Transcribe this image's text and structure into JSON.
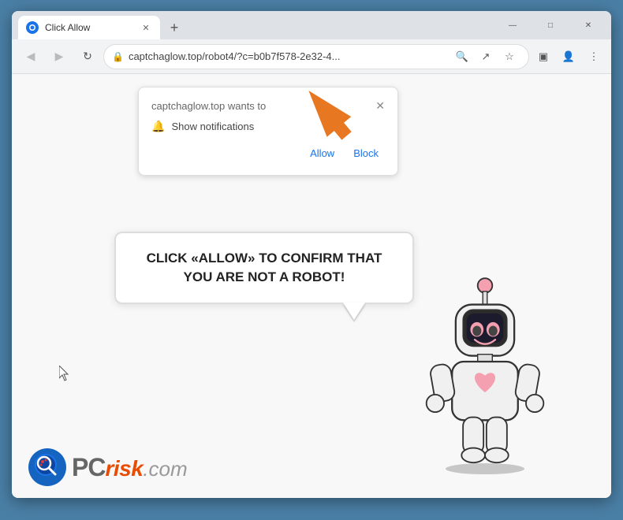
{
  "browser": {
    "tab": {
      "title": "Click Allow",
      "favicon_label": "chrome-favicon"
    },
    "window_controls": {
      "minimize": "—",
      "maximize": "□",
      "close": "✕"
    },
    "nav": {
      "back_label": "◀",
      "forward_label": "▶",
      "reload_label": "↻",
      "url": "captchaglow.top/robot4/?c=b0b7f578-2e32-4...",
      "search_icon": "🔍",
      "share_icon": "↗",
      "bookmark_icon": "☆",
      "extensions_icon": "▣",
      "profile_icon": "👤",
      "menu_icon": "⋮"
    },
    "new_tab_btn": "+"
  },
  "notification_popup": {
    "title": "captchaglow.top wants to",
    "close_btn": "✕",
    "bell_icon": "🔔",
    "notification_text": "Show notifications",
    "allow_btn": "Allow",
    "block_btn": "Block"
  },
  "speech_bubble": {
    "text": "CLICK «ALLOW» TO CONFIRM THAT YOU ARE NOT A ROBOT!"
  },
  "pcrisk": {
    "name_pc": "PC",
    "name_risk": "risk",
    "name_dotcom": ".com"
  }
}
